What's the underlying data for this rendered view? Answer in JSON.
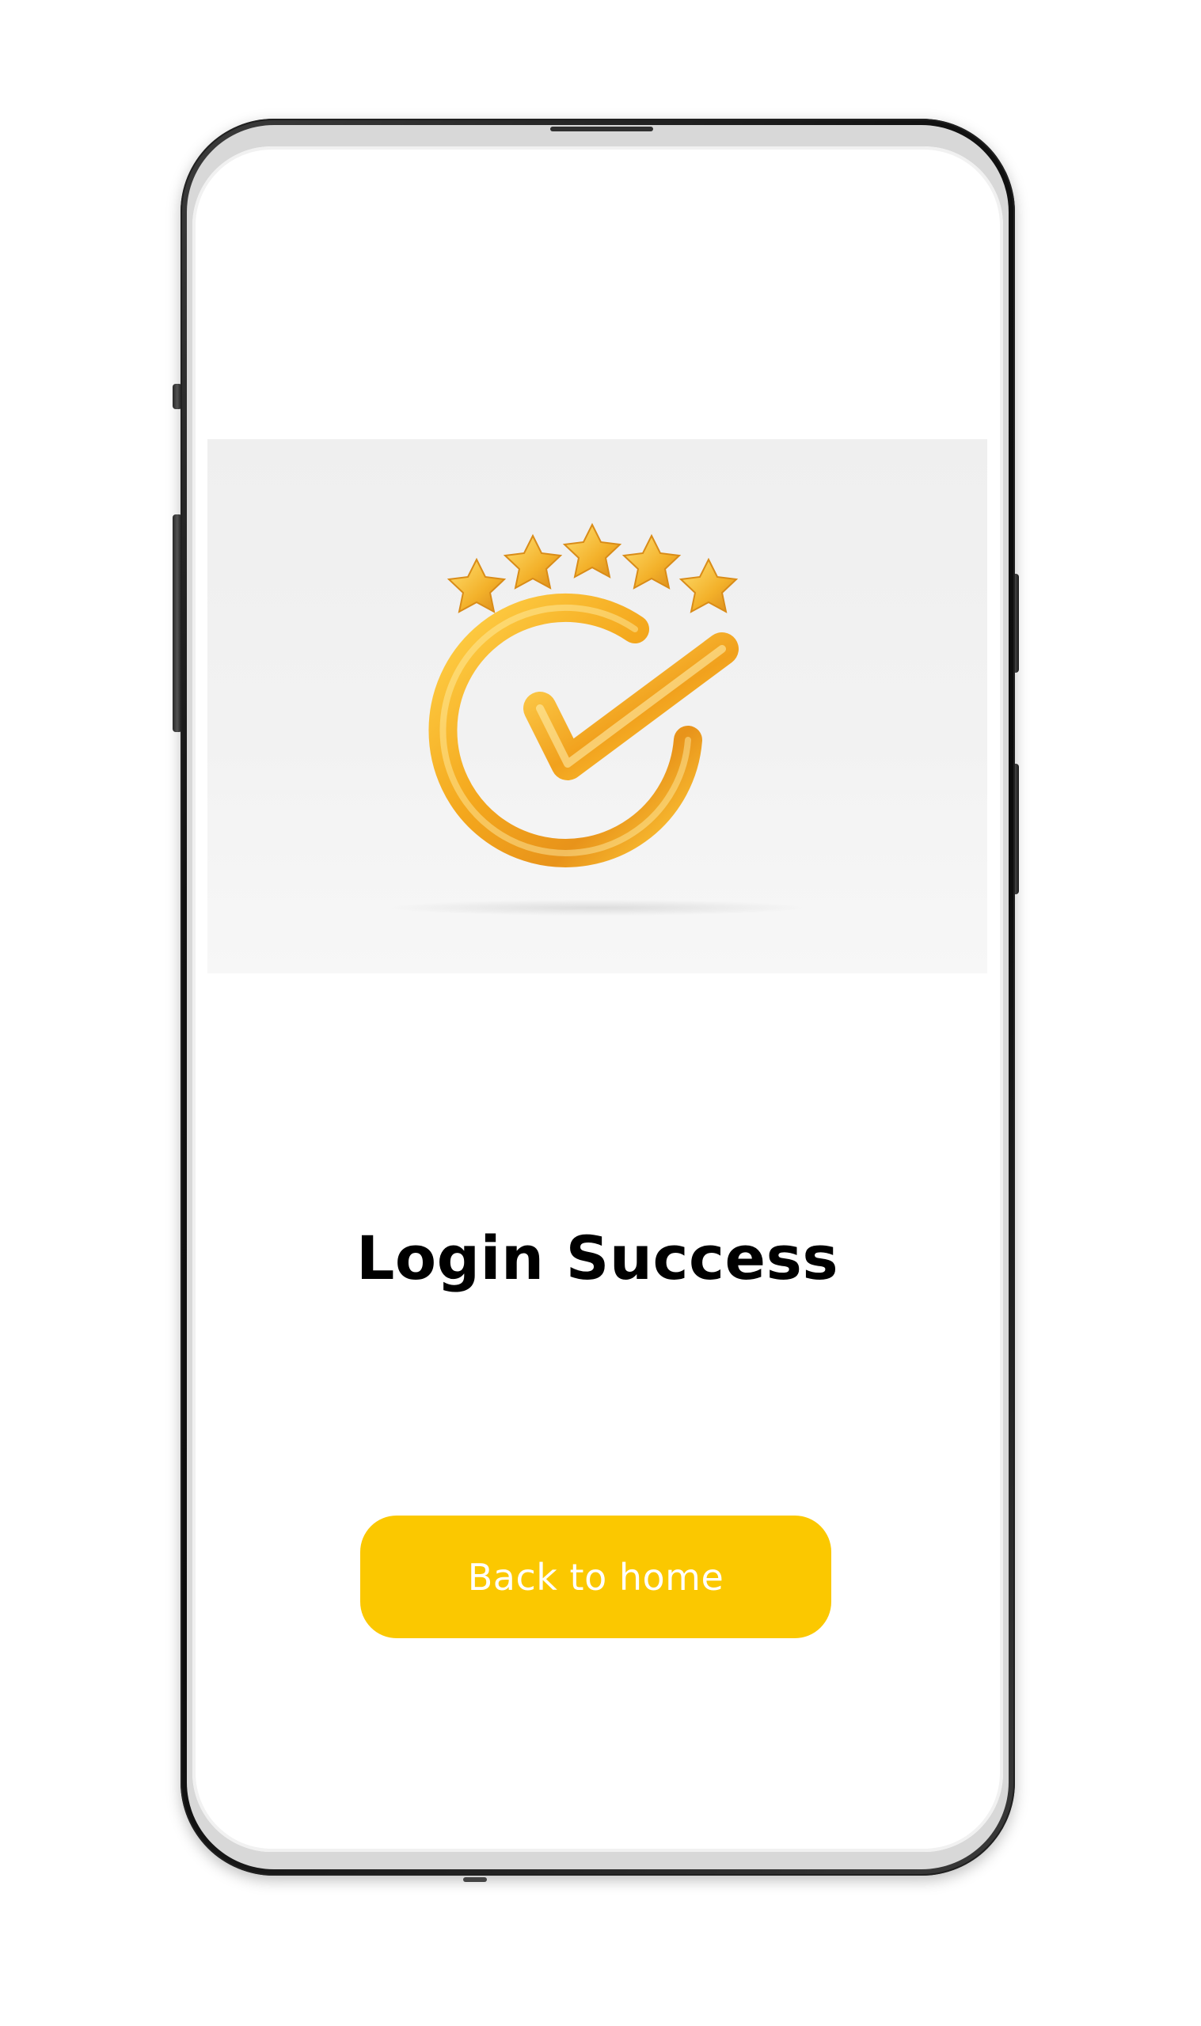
{
  "screen": {
    "title": "Login Success",
    "primary_button_label": "Back to home"
  },
  "illustration": {
    "icon": "check-circle-with-five-stars-icon",
    "star_count": 5
  },
  "colors": {
    "accent": "#fbc800",
    "title_text": "#000000",
    "button_text": "#ffffff",
    "illustration_bg": "#efefef",
    "gold": "#f6b51f"
  }
}
